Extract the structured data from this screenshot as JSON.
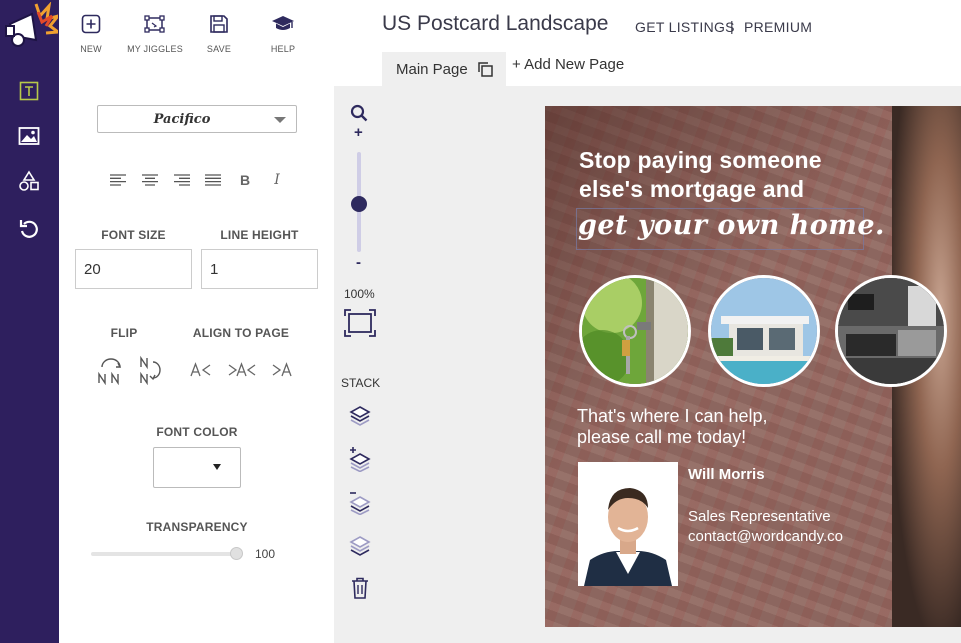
{
  "toolbar": {
    "new_label": "NEW",
    "jiggles_label": "MY JIGGLES",
    "save_label": "SAVE",
    "help_label": "HELP"
  },
  "header": {
    "title": "US Postcard Landscape",
    "get_listings": "GET LISTINGS",
    "separator": "|",
    "premium": "PREMIUM"
  },
  "tabs": {
    "main_page": "Main Page",
    "add_page": "+ Add New Page"
  },
  "rail": {
    "tools": [
      "text-tool-icon",
      "image-tool-icon",
      "shapes-tool-icon",
      "undo-icon"
    ],
    "accent": "#b7c94a",
    "bg": "#2e1f5e"
  },
  "panel": {
    "font_family": "Pacifico",
    "font_size_label": "FONT SIZE",
    "font_size": "20",
    "line_height_label": "LINE HEIGHT",
    "line_height": "1",
    "flip_label": "FLIP",
    "align_label": "ALIGN TO PAGE",
    "font_color_label": "FONT COLOR",
    "transparency_label": "TRANSPARENCY",
    "transparency": "100",
    "bold": "B",
    "italic": "I"
  },
  "canvas": {
    "zoom_plus": "+",
    "zoom_minus": "-",
    "zoom_level": "100%",
    "stack_label": "STACK"
  },
  "postcard": {
    "headline_line1": "Stop paying someone",
    "headline_line2": "else's mortgage and",
    "script_line": "get your own home.",
    "sub_line1": "That's where I can help,",
    "sub_line2": "please call me today!",
    "agent_name": "Will Morris",
    "agent_role": "Sales Representative",
    "agent_email": "contact@wordcandy.co"
  }
}
